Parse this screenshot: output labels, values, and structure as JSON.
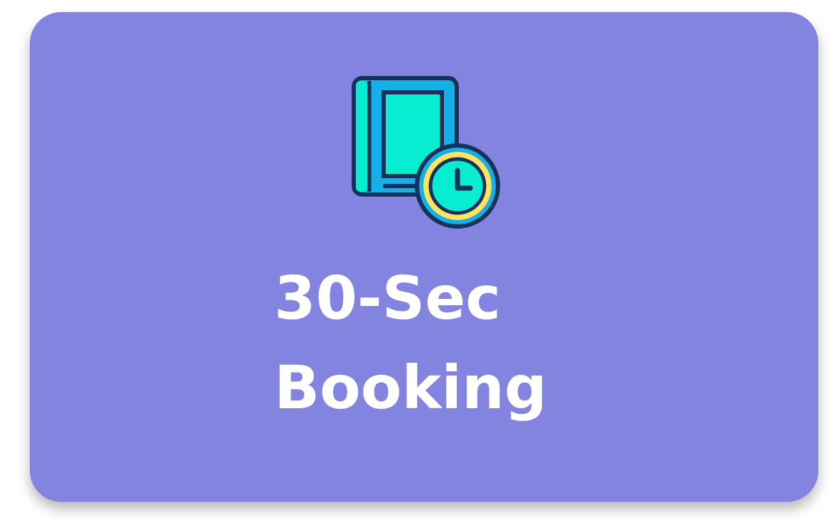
{
  "card": {
    "title_line_1": "30-Sec",
    "title_line_2": "Booking",
    "background_color": "#8383e0",
    "text_color": "#ffffff"
  },
  "icon": {
    "name": "book-with-clock-icon",
    "book_color": "#16b0e8",
    "page_color": "#08ecd1",
    "clock_ring_color": "#ffe35c",
    "clock_face_color": "#08ecd1",
    "outline_color": "#15325a"
  }
}
